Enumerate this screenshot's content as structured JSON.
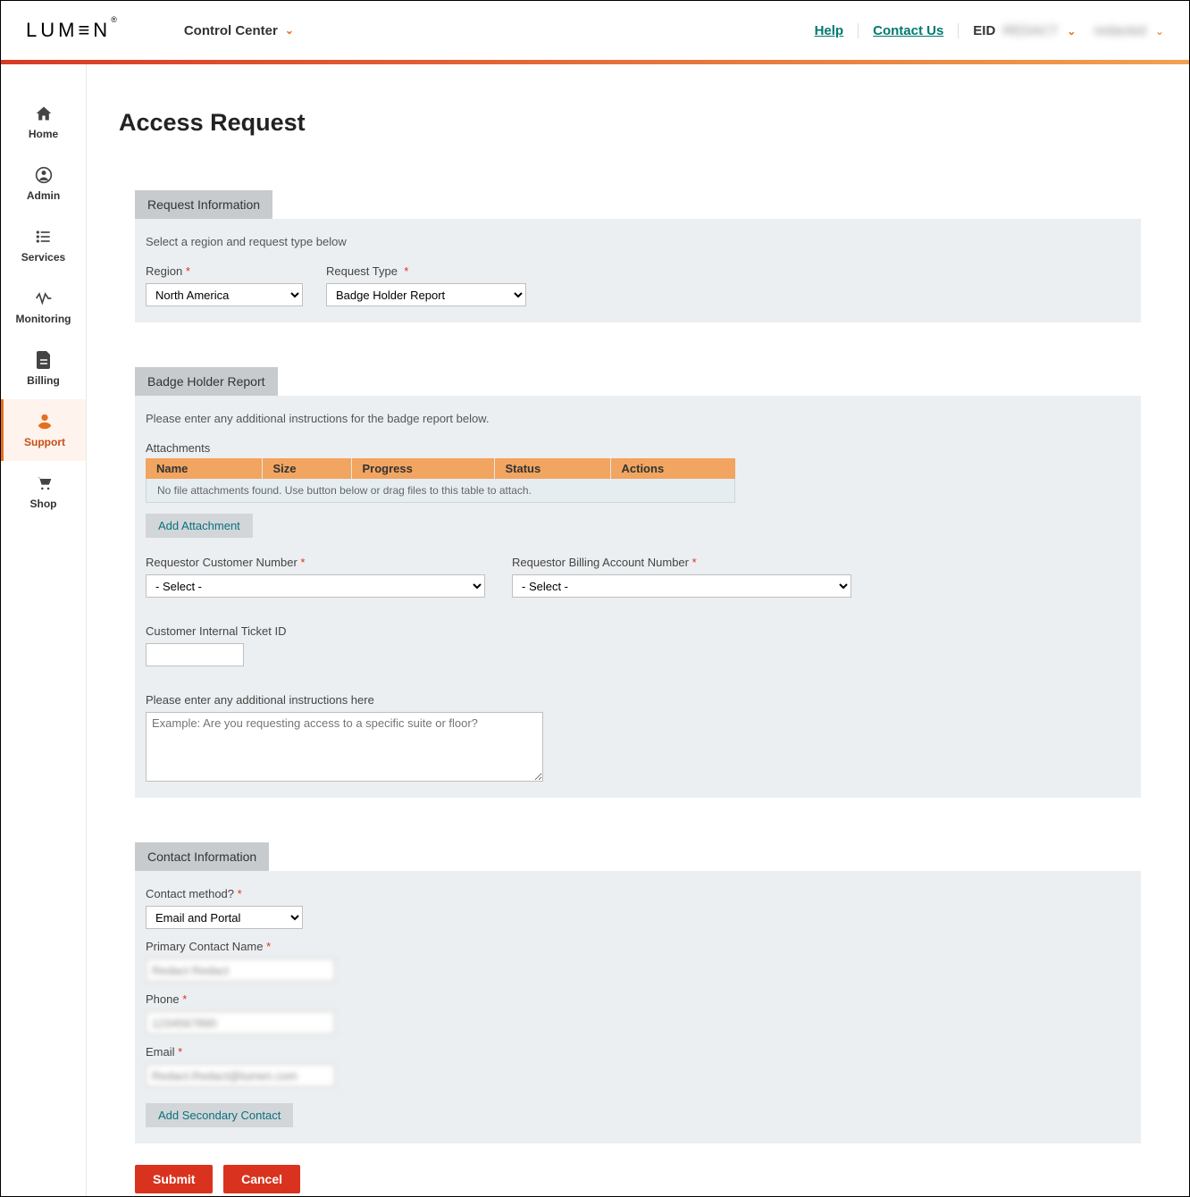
{
  "header": {
    "logo": "LUM≡N",
    "logo_reg": "®",
    "control_center": "Control Center",
    "help": "Help",
    "contact_us": "Contact Us",
    "eid_label": "EID",
    "eid_value": "REDACT",
    "user_name": "redacted"
  },
  "sidebar": {
    "items": [
      {
        "label": "Home"
      },
      {
        "label": "Admin"
      },
      {
        "label": "Services"
      },
      {
        "label": "Monitoring"
      },
      {
        "label": "Billing"
      },
      {
        "label": "Support"
      },
      {
        "label": "Shop"
      }
    ]
  },
  "page": {
    "title": "Access Request"
  },
  "request_info": {
    "tab": "Request Information",
    "helper": "Select a region and request type below",
    "region_label": "Region",
    "region_value": "North America",
    "type_label": "Request Type",
    "type_value": "Badge Holder Report"
  },
  "badge_report": {
    "tab": "Badge Holder Report",
    "helper": "Please enter any additional instructions for the badge report below.",
    "attachments_label": "Attachments",
    "cols": {
      "name": "Name",
      "size": "Size",
      "progress": "Progress",
      "status": "Status",
      "actions": "Actions"
    },
    "empty_msg": "No file attachments found. Use button below or drag files to this table to attach.",
    "add_attachment": "Add Attachment",
    "req_cust_num_label": "Requestor Customer Number",
    "req_cust_num_value": "- Select -",
    "req_bill_acct_label": "Requestor Billing Account Number",
    "req_bill_acct_value": "- Select -",
    "cust_ticket_label": "Customer Internal Ticket ID",
    "instructions_label": "Please enter any additional instructions here",
    "instructions_placeholder": "Example: Are you requesting access to a specific suite or floor?"
  },
  "contact": {
    "tab": "Contact Information",
    "method_label": "Contact method?",
    "method_value": "Email and Portal",
    "primary_name_label": "Primary Contact Name",
    "primary_name_value": "Redact Redact",
    "phone_label": "Phone",
    "phone_value": "1234567890",
    "email_label": "Email",
    "email_value": "Redact.Redact@lumen.com",
    "add_secondary": "Add Secondary Contact"
  },
  "actions": {
    "submit": "Submit",
    "cancel": "Cancel"
  }
}
